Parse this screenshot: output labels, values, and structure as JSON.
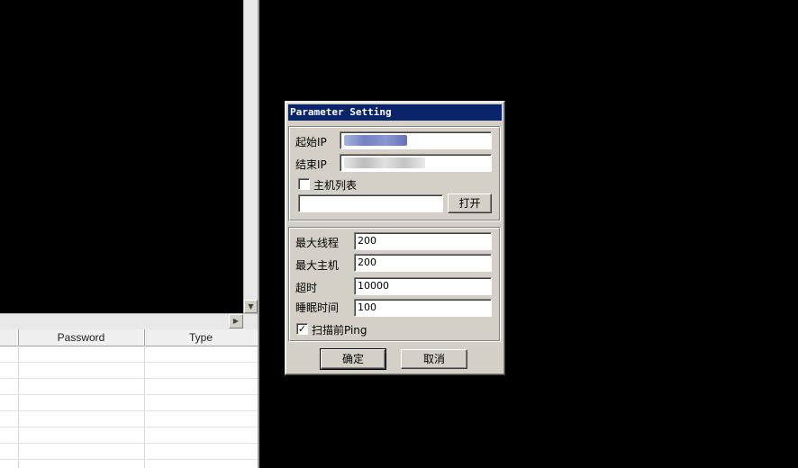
{
  "background_grid": {
    "columns": [
      "Password",
      "Type"
    ]
  },
  "dialog": {
    "title": "Parameter Setting",
    "start_ip_label": "起始IP",
    "end_ip_label": "结束IP",
    "host_list_label": "主机列表",
    "host_list_checked": false,
    "host_list_path": "",
    "open_button": "打开",
    "max_threads_label": "最大线程",
    "max_threads_value": "200",
    "max_hosts_label": "最大主机",
    "max_hosts_value": "200",
    "timeout_label": "超时",
    "timeout_value": "10000",
    "sleep_label": "睡眠时间",
    "sleep_value": "100",
    "ping_label": "扫描前Ping",
    "ping_checked": true,
    "ok_button": "确定",
    "cancel_button": "取消"
  },
  "colors": {
    "titlebar": "#0a246a",
    "dialog_face": "#d4d0c8",
    "desktop": "#000000"
  }
}
